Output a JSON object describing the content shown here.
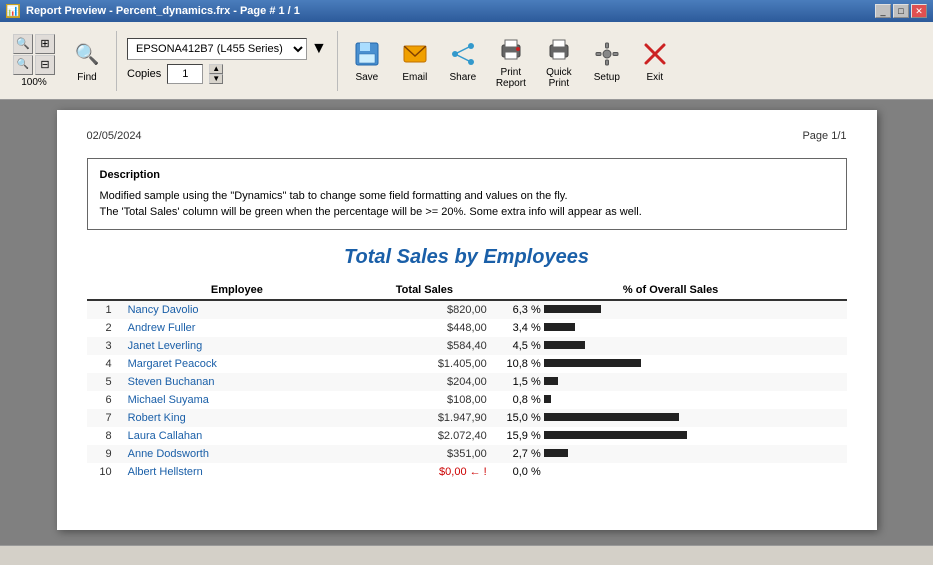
{
  "titleBar": {
    "title": "Report Preview - Percent_dynamics.frx - Page # 1 / 1",
    "icon": "📊",
    "controls": [
      "_",
      "□",
      "✕"
    ]
  },
  "toolbar": {
    "zoom": {
      "label": "Zoom",
      "value": "100%",
      "pct_label": "100%"
    },
    "zoomBtns": [
      "+",
      "-",
      "⊞",
      "⊟"
    ],
    "find_label": "Find",
    "printer": {
      "label": "EPSONA412B7 (L455 Series)",
      "options": [
        "EPSONA412B7 (L455 Series)"
      ]
    },
    "copies_label": "Copies",
    "copies_value": "1",
    "save_label": "Save",
    "email_label": "Email",
    "share_label": "Share",
    "print_report_label": "Print\nReport",
    "quick_print_label": "Quick\nPrint",
    "setup_label": "Setup",
    "exit_label": "Exit"
  },
  "report": {
    "date": "02/05/2024",
    "page": "Page 1/1",
    "description_title": "Description",
    "description_line1": "Modified sample using the \"Dynamics\" tab to change some field formatting and values on the fly.",
    "description_line2": "The 'Total Sales' column will be green when the percentage will be >= 20%. Some extra info will appear as well.",
    "report_title": "Total Sales by Employees",
    "col_employee": "Employee",
    "col_total_sales": "Total Sales",
    "col_pct": "% of Overall Sales",
    "rows": [
      {
        "num": "1",
        "name": "Nancy Davolio",
        "sales": "$820,00",
        "pct": "6,3",
        "bar": 63,
        "style": "normal"
      },
      {
        "num": "2",
        "name": "Andrew Fuller",
        "sales": "$448,00",
        "pct": "3,4",
        "bar": 34,
        "style": "normal"
      },
      {
        "num": "3",
        "name": "Janet Leverling",
        "sales": "$584,40",
        "pct": "4,5",
        "bar": 45,
        "style": "normal"
      },
      {
        "num": "4",
        "name": "Margaret Peacock",
        "sales": "$1.405,00",
        "pct": "10,8",
        "bar": 108,
        "style": "normal"
      },
      {
        "num": "5",
        "name": "Steven Buchanan",
        "sales": "$204,00",
        "pct": "1,5",
        "bar": 15,
        "style": "normal"
      },
      {
        "num": "6",
        "name": "Michael Suyama",
        "sales": "$108,00",
        "pct": "0,8",
        "bar": 8,
        "style": "normal"
      },
      {
        "num": "7",
        "name": "Robert King",
        "sales": "$1.947,90",
        "pct": "15,0",
        "bar": 150,
        "style": "normal"
      },
      {
        "num": "8",
        "name": "Laura Callahan",
        "sales": "$2.072,40",
        "pct": "15,9",
        "bar": 159,
        "style": "normal"
      },
      {
        "num": "9",
        "name": "Anne Dodsworth",
        "sales": "$351,00",
        "pct": "2,7",
        "bar": 27,
        "style": "normal"
      },
      {
        "num": "10",
        "name": "Albert Hellstern",
        "sales": "$0,00",
        "pct": "0,0",
        "bar": 0,
        "style": "red"
      }
    ]
  },
  "statusBar": {
    "text": ""
  }
}
